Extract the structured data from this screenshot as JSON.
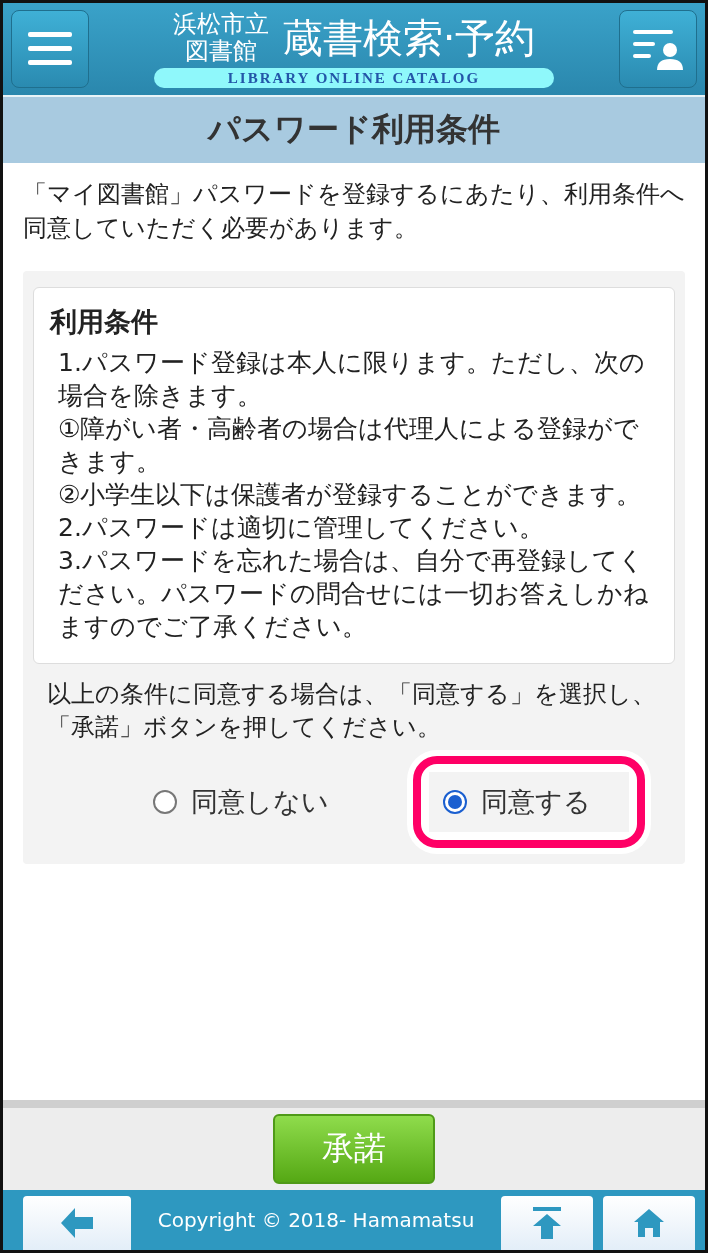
{
  "header": {
    "logo_line1": "浜松市立",
    "logo_line2": "図書館",
    "logo_title": "蔵書検索·予約",
    "logo_subtitle": "LIBRARY ONLINE CATALOG"
  },
  "page_title": "パスワード利用条件",
  "intro": "「マイ図書館」パスワードを登録するにあたり、利用条件へ同意していただく必要があります。",
  "terms": {
    "title": "利用条件",
    "lines": [
      "1.パスワード登録は本人に限ります。ただし、次の場合を除きます。",
      "①障がい者・高齢者の場合は代理人による登録ができます。",
      "②小学生以下は保護者が登録することができます。",
      "2.パスワードは適切に管理してください。",
      "3.パスワードを忘れた場合は、自分で再登録してください。パスワードの問合せには一切お答えしかねますのでご了承ください。"
    ]
  },
  "consent_text": "以上の条件に同意する場合は、「同意する」を選択し、「承諾」ボタンを押してください。",
  "options": [
    {
      "label": "同意しない",
      "selected": false
    },
    {
      "label": "同意する",
      "selected": true
    }
  ],
  "accept_button": "承諾",
  "footer": {
    "copyright": "Copyright © 2018- Hamamatsu"
  }
}
